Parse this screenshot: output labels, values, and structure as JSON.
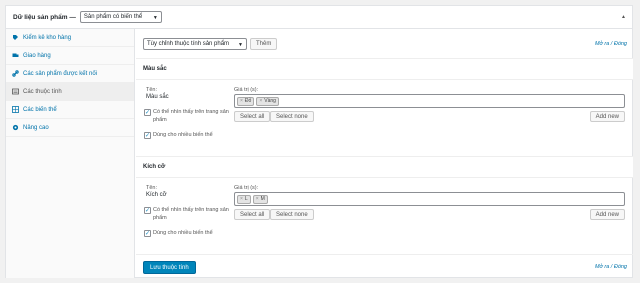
{
  "header": {
    "title": "Dữ liệu sản phẩm —",
    "product_type": "Sản phẩm có biến thể"
  },
  "sidebar": {
    "items": [
      {
        "label": "Kiểm kê kho hàng",
        "icon": "inventory-icon"
      },
      {
        "label": "Giao hàng",
        "icon": "truck-icon"
      },
      {
        "label": "Các sản phẩm được kết nối",
        "icon": "link-icon"
      },
      {
        "label": "Các thuộc tính",
        "icon": "attributes-icon"
      },
      {
        "label": "Các biến thể",
        "icon": "grid-icon"
      },
      {
        "label": "Nâng cao",
        "icon": "gear-icon"
      }
    ]
  },
  "toolbar": {
    "attribute_select": "Tùy chỉnh thuộc tính sản phẩm",
    "add_label": "Thêm",
    "expand_links": "Mở ra / Đóng"
  },
  "attributes": [
    {
      "heading": "Màu sắc",
      "name_label": "Tên:",
      "name_value": "Màu sắc",
      "values_label": "Giá trị (s):",
      "values": [
        "Đỏ",
        "Vàng"
      ],
      "visible_label": "Có thể nhìn thấy trên trang sản phẩm",
      "variation_label": "Dùng cho nhiều biến thể",
      "select_all": "Select all",
      "select_none": "Select none",
      "add_new": "Add new"
    },
    {
      "heading": "Kích cỡ",
      "name_label": "Tên:",
      "name_value": "Kích cỡ",
      "values_label": "Giá trị (s):",
      "values": [
        "L",
        "M"
      ],
      "visible_label": "Có thể nhìn thấy trên trang sản phẩm",
      "variation_label": "Dùng cho nhiều biến thể",
      "select_all": "Select all",
      "select_none": "Select none",
      "add_new": "Add new"
    }
  ],
  "footer": {
    "save_label": "Lưu thuộc tính",
    "expand_links": "Mở ra / Đóng"
  },
  "colors": {
    "link": "#0073aa",
    "primary_button": "#0085ba"
  }
}
